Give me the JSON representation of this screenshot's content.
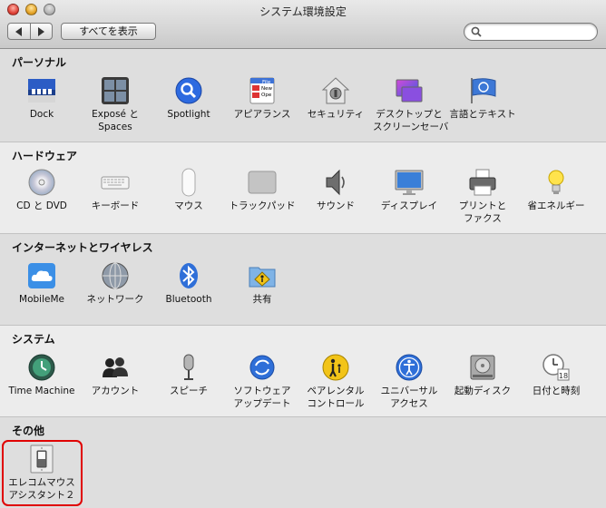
{
  "window": {
    "title": "システム環境設定"
  },
  "toolbar": {
    "show_all": "すべてを表示",
    "search_placeholder": "",
    "back": "◀",
    "forward": "▶"
  },
  "sections": [
    {
      "title": "パーソナル",
      "items": [
        {
          "label1": "Dock",
          "label2": ""
        },
        {
          "label1": "Exposé と",
          "label2": "Spaces"
        },
        {
          "label1": "Spotlight",
          "label2": ""
        },
        {
          "label1": "アピアランス",
          "label2": ""
        },
        {
          "label1": "セキュリティ",
          "label2": ""
        },
        {
          "label1": "デスクトップと",
          "label2": "スクリーンセーバ"
        },
        {
          "label1": "言語とテキスト",
          "label2": ""
        }
      ]
    },
    {
      "title": "ハードウェア",
      "items": [
        {
          "label1": "CD と DVD",
          "label2": ""
        },
        {
          "label1": "キーボード",
          "label2": ""
        },
        {
          "label1": "マウス",
          "label2": ""
        },
        {
          "label1": "トラックパッド",
          "label2": ""
        },
        {
          "label1": "サウンド",
          "label2": ""
        },
        {
          "label1": "ディスプレイ",
          "label2": ""
        },
        {
          "label1": "プリントと",
          "label2": "ファクス"
        },
        {
          "label1": "省エネルギー",
          "label2": ""
        }
      ]
    },
    {
      "title": "インターネットとワイヤレス",
      "items": [
        {
          "label1": "MobileMe",
          "label2": ""
        },
        {
          "label1": "ネットワーク",
          "label2": ""
        },
        {
          "label1": "Bluetooth",
          "label2": ""
        },
        {
          "label1": "共有",
          "label2": ""
        }
      ]
    },
    {
      "title": "システム",
      "items": [
        {
          "label1": "Time Machine",
          "label2": ""
        },
        {
          "label1": "アカウント",
          "label2": ""
        },
        {
          "label1": "スピーチ",
          "label2": ""
        },
        {
          "label1": "ソフトウェア",
          "label2": "アップデート"
        },
        {
          "label1": "ペアレンタル",
          "label2": "コントロール"
        },
        {
          "label1": "ユニバーサル",
          "label2": "アクセス"
        },
        {
          "label1": "起動ディスク",
          "label2": ""
        },
        {
          "label1": "日付と時刻",
          "label2": ""
        }
      ]
    },
    {
      "title": "その他",
      "items": [
        {
          "label1": "エレコムマウス",
          "label2": "アシスタント２"
        }
      ]
    }
  ],
  "icon_texts": {
    "appearance_file": "File",
    "appearance_new": "New",
    "appearance_open": "Ope",
    "calendar_day": "18"
  },
  "colors": {
    "highlight": "#e00000"
  }
}
